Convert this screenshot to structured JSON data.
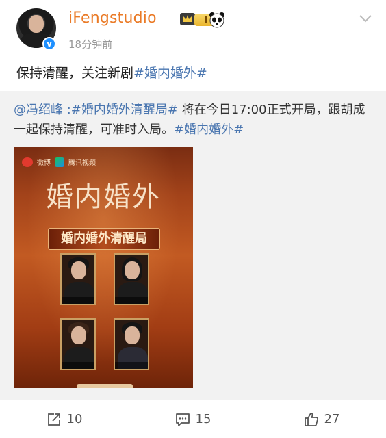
{
  "author": {
    "username": "iFengstudio",
    "level_badge": "I",
    "timestamp": "18分钟前",
    "verified_mark": "v"
  },
  "post": {
    "text": "保持清醒，关注新剧",
    "hashtag": "#婚内婚外#"
  },
  "repost": {
    "mention": "@冯绍峰",
    "hashtag_1": ":#婚内婚外清醒局#",
    "text": " 将在今日17:00正式开局，跟胡成一起保持清醒，可准时入局。",
    "hashtag_2": "#婚内婚外#"
  },
  "poster": {
    "logo_weibo": "微博",
    "logo_tencent": "腾讯视频",
    "title": "婚内婚外",
    "subtitle": "婚内婚外清醒局"
  },
  "actions": {
    "repost_count": "10",
    "comment_count": "15",
    "like_count": "27"
  },
  "colors": {
    "username": "#ea7a26",
    "link": "#4a76b0",
    "card_bg": "#f2f2f2"
  },
  "icons": [
    "verified-icon",
    "crown-icon",
    "panda-icon",
    "chevron-down-icon",
    "share-icon",
    "comment-icon",
    "like-icon"
  ]
}
